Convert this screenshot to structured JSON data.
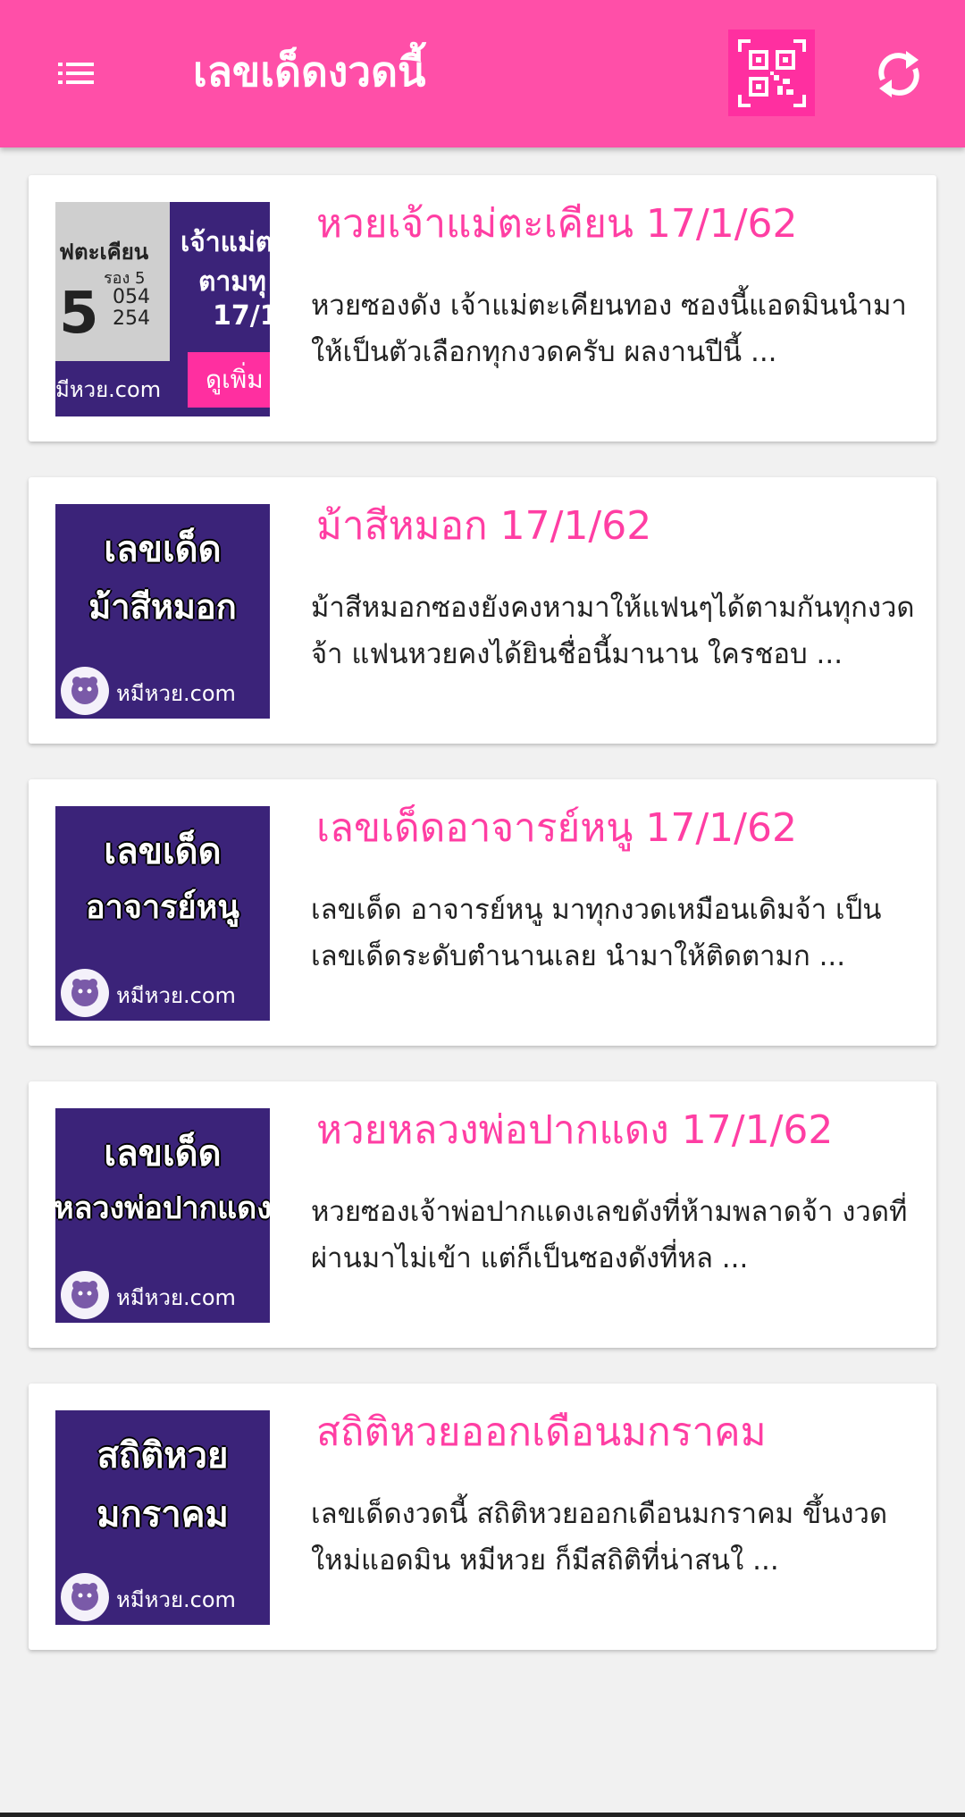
{
  "app_bar": {
    "title": "เลขเด็ดงวดนี้",
    "menu_icon": "menu-icon",
    "qr_icon": "qr-code-icon",
    "refresh_icon": "refresh-icon",
    "background_color": "#ff4fa8"
  },
  "posts": [
    {
      "title": "หวยเจ้าแม่ตะเคียน 17/1/62",
      "desc_line1": "หวยซองดัง เจ้าแม่ตะเคียนทอง ซองนี้แอดมินนำมา",
      "desc_line2": "ให้เป็นตัวเลือกทุกงวดครับ ผลงานปีนี้ ...",
      "thumb": {
        "paper_text": "ฟตะเคียน",
        "big_number": "5",
        "paper_sub1": "รอง 5",
        "paper_sub2": "054",
        "paper_sub3": "254",
        "right1": "เจ้าแม่ต",
        "right2": "ตามทุ",
        "right3": "17/1",
        "button": "ดูเพิ่ม",
        "brand": "มีหวย.com"
      }
    },
    {
      "title": "ม้าสีหมอก 17/1/62",
      "desc_line1": "ม้าสีหมอกซองยังคงหามาให้แฟนๆได้ตามกันทุกงวด",
      "desc_line2": "จ้า แฟนหวยคงได้ยินชื่อนี้มานาน ใครชอบ ...",
      "thumb": {
        "line1": "เลขเด็ด",
        "line2": "ม้าสีหมอก",
        "brand": "หมีหวย.com"
      }
    },
    {
      "title": "เลขเด็ดอาจารย์หนู 17/1/62",
      "desc_line1": "เลขเด็ด อาจารย์หนู มาทุกงวดเหมือนเดิมจ้า เป็น",
      "desc_line2": "เลขเด็ดระดับตำนานเลย นำมาให้ติดตามก ...",
      "thumb": {
        "line1": "เลขเด็ด",
        "line2": "อาจารย์หนู",
        "brand": "หมีหวย.com"
      }
    },
    {
      "title": "หวยหลวงพ่อปากแดง 17/1/62",
      "desc_line1": "หวยซองเจ้าพ่อปากแดงเลขดังที่ห้ามพลาดจ้า งวดที่",
      "desc_line2": "ผ่านมาไม่เข้า แต่ก็เป็นซองดังที่หล ...",
      "thumb": {
        "line1": "เลขเด็ด",
        "line2": "หลวงพ่อปากแดง",
        "brand": "หมีหวย.com"
      }
    },
    {
      "title": "สถิติหวยออกเดือนมกราคม",
      "desc_line1": "เลขเด็ดงวดนี้ สถิติหวยออกเดือนมกราคม ขึ้นงวด",
      "desc_line2": "ใหม่แอดมิน หมีหวย ก็มีสถิติที่น่าสนใ ...",
      "thumb": {
        "line1": "สถิติหวย",
        "line2": "มกราคม",
        "brand": "หมีหวย.com"
      }
    }
  ]
}
